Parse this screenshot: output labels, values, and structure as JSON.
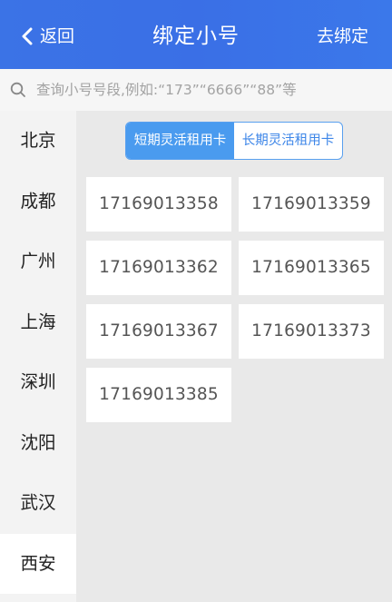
{
  "header": {
    "back_label": "返回",
    "title": "绑定小号",
    "action_label": "去绑定"
  },
  "search": {
    "placeholder": "查询小号号段,例如:“173”“6666”“88”等"
  },
  "sidebar": {
    "items": [
      "北京",
      "成都",
      "广州",
      "上海",
      "深圳",
      "沈阳",
      "武汉",
      "西安"
    ],
    "active_index": 7
  },
  "tabs": {
    "items": [
      "短期灵活租用卡",
      "长期灵活租用卡"
    ],
    "active_index": 0
  },
  "numbers": [
    "17169013358",
    "17169013359",
    "17169013362",
    "17169013365",
    "17169013367",
    "17169013373",
    "17169013385"
  ],
  "colors": {
    "header": "#3a6fe6",
    "accent": "#4a9bef"
  }
}
